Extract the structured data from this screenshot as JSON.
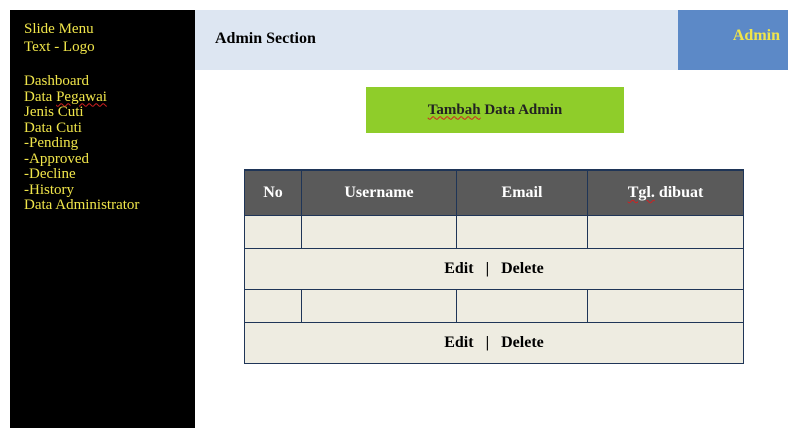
{
  "sidebar": {
    "logo_line1": "Slide Menu",
    "logo_line2": "Text - Logo",
    "items": [
      "Dashboard",
      "Data Pegawai",
      "Jenis Cuti",
      "Data Cuti",
      "-Pending",
      "-Approved",
      "-Decline",
      "-History",
      "Data Administrator"
    ]
  },
  "header": {
    "title": "Admin Section",
    "user": "Admin"
  },
  "actions": {
    "add_button": "Tambah Data Admin"
  },
  "table": {
    "columns": [
      "No",
      "Username",
      "Email",
      "Tgl. dibuat"
    ],
    "edit_label": "Edit",
    "separator": "|",
    "delete_label": "Delete"
  },
  "colors": {
    "sidebar_bg": "#000000",
    "sidebar_text": "#f0e54a",
    "header_bg": "#dde6f2",
    "admin_bg": "#5c89c7",
    "button_bg": "#8fcd2a",
    "table_header_bg": "#5a5a5a",
    "table_cell_bg": "#eeece1"
  }
}
